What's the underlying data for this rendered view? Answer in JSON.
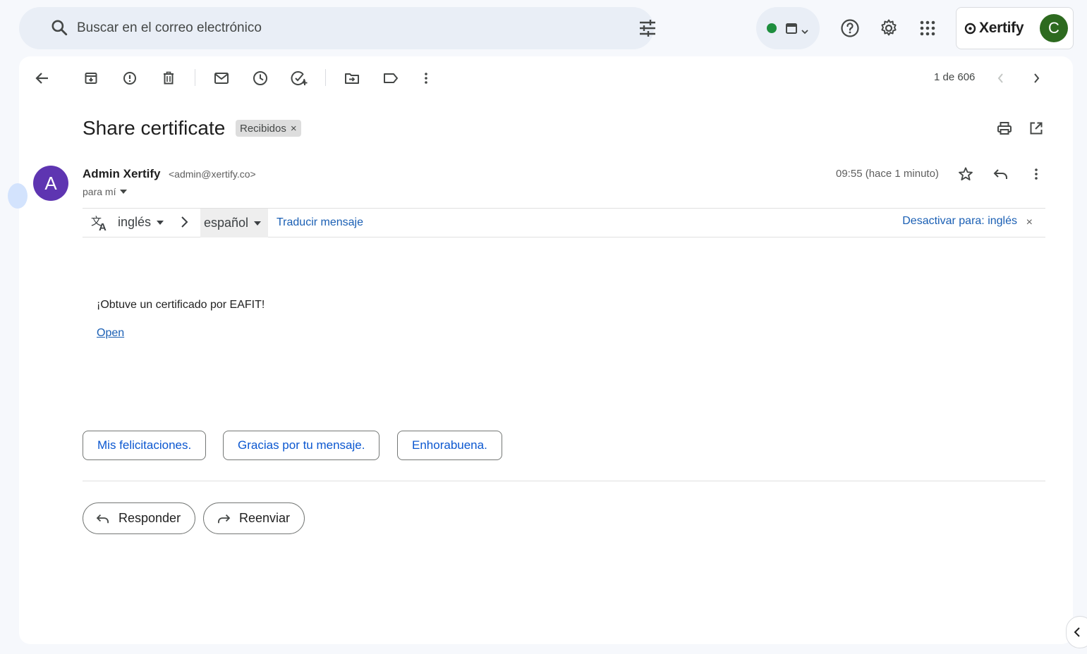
{
  "search": {
    "placeholder": "Buscar en el correo electrónico"
  },
  "status": {
    "dot_color": "#1e8e3e"
  },
  "account": {
    "brand": "Xertify",
    "avatar_letter": "C",
    "avatar_color": "#2d6a1f"
  },
  "toolbar": {
    "pager": "1 de 606"
  },
  "email": {
    "subject": "Share certificate",
    "label": "Recibidos",
    "label_close": "×",
    "sender_initial": "A",
    "sender_name": "Admin Xertify",
    "sender_email": "<admin@xertify.co>",
    "recipient": "para mí",
    "time": "09:55 (hace 1 minuto)",
    "body_text": "¡Obtuve un certificado por EAFIT!",
    "body_link": "Open"
  },
  "translate": {
    "source_lang": "inglés",
    "target_lang": "español",
    "translate_link": "Traducir mensaje",
    "disable_link": "Desactivar para: inglés",
    "close": "×"
  },
  "smart_replies": [
    "Mis felicitaciones.",
    "Gracias por tu mensaje.",
    "Enhorabuena."
  ],
  "actions": {
    "reply": "Responder",
    "forward": "Reenviar"
  }
}
